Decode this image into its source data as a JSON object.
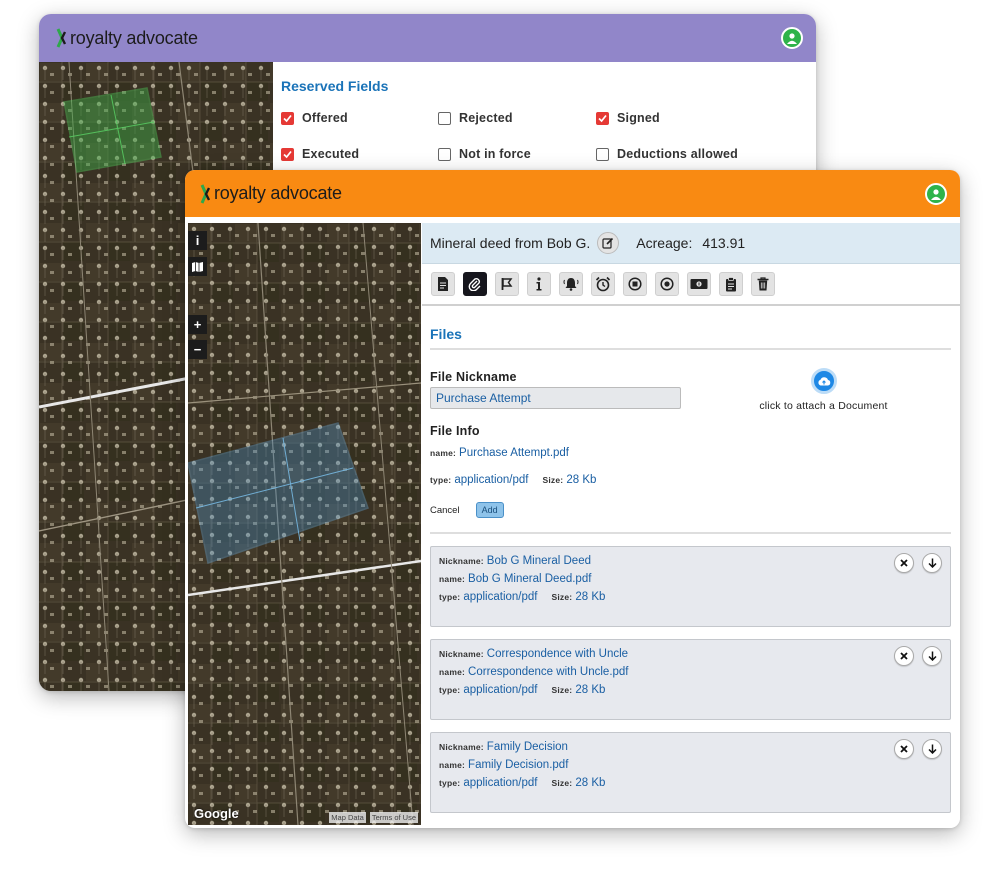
{
  "back_window": {
    "app_name": "royalty advocate",
    "header_color": "#9186c9",
    "reserved_fields": {
      "title": "Reserved Fields",
      "checkboxes": [
        {
          "label": "Offered",
          "checked": true
        },
        {
          "label": "Rejected",
          "checked": false
        },
        {
          "label": "Signed",
          "checked": true
        },
        {
          "label": "Executed",
          "checked": true
        },
        {
          "label": "Not in force",
          "checked": false
        },
        {
          "label": "Deductions allowed",
          "checked": false
        }
      ]
    }
  },
  "front_window": {
    "app_name": "royalty advocate",
    "header_color": "#f98a12",
    "map": {
      "zoom_in": "+",
      "zoom_out": "−",
      "info_btn": "i",
      "google_logo": "Google",
      "attribution": {
        "map_data": "Map Data",
        "terms": "Terms of Use"
      }
    },
    "deed": {
      "title": "Mineral deed from Bob G.",
      "acreage_label": "Acreage:",
      "acreage_value": "413.91"
    },
    "toolbar": [
      {
        "icon": "document-icon",
        "active": false
      },
      {
        "icon": "paperclip-icon",
        "active": true
      },
      {
        "icon": "flag-icon",
        "active": false
      },
      {
        "icon": "info-icon",
        "active": false
      },
      {
        "icon": "bell-icon",
        "active": false
      },
      {
        "icon": "alarm-clock-icon",
        "active": false
      },
      {
        "icon": "stop-circle-icon",
        "active": false
      },
      {
        "icon": "record-circle-icon",
        "active": false
      },
      {
        "icon": "money-icon",
        "active": false
      },
      {
        "icon": "clipboard-icon",
        "active": false
      },
      {
        "icon": "trash-icon",
        "active": false
      }
    ],
    "files": {
      "title": "Files",
      "nickname_label": "File Nickname",
      "nickname_value": "Purchase Attempt",
      "attach_label": "click to attach a Document",
      "info_label": "File Info",
      "name_key": "name:",
      "name_value": "Purchase Attempt.pdf",
      "type_key": "type:",
      "type_value": "application/pdf",
      "size_key": "Size:",
      "size_value": "28 Kb",
      "cancel_label": "Cancel",
      "add_label": "Add",
      "list": [
        {
          "nickname_key": "Nickname:",
          "nickname": "Bob G Mineral Deed",
          "name_key": "name:",
          "name": "Bob G Mineral Deed.pdf",
          "type_key": "type:",
          "type": "application/pdf",
          "size_key": "Size:",
          "size": "28 Kb"
        },
        {
          "nickname_key": "Nickname:",
          "nickname": "Correspondence with Uncle",
          "name_key": "name:",
          "name": "Correspondence with Uncle.pdf",
          "type_key": "type:",
          "type": "application/pdf",
          "size_key": "Size:",
          "size": "28 Kb"
        },
        {
          "nickname_key": "Nickname:",
          "nickname": "Family Decision",
          "name_key": "name:",
          "name": "Family Decision.pdf",
          "type_key": "type:",
          "type": "application/pdf",
          "size_key": "Size:",
          "size": "28 Kb"
        }
      ]
    }
  }
}
